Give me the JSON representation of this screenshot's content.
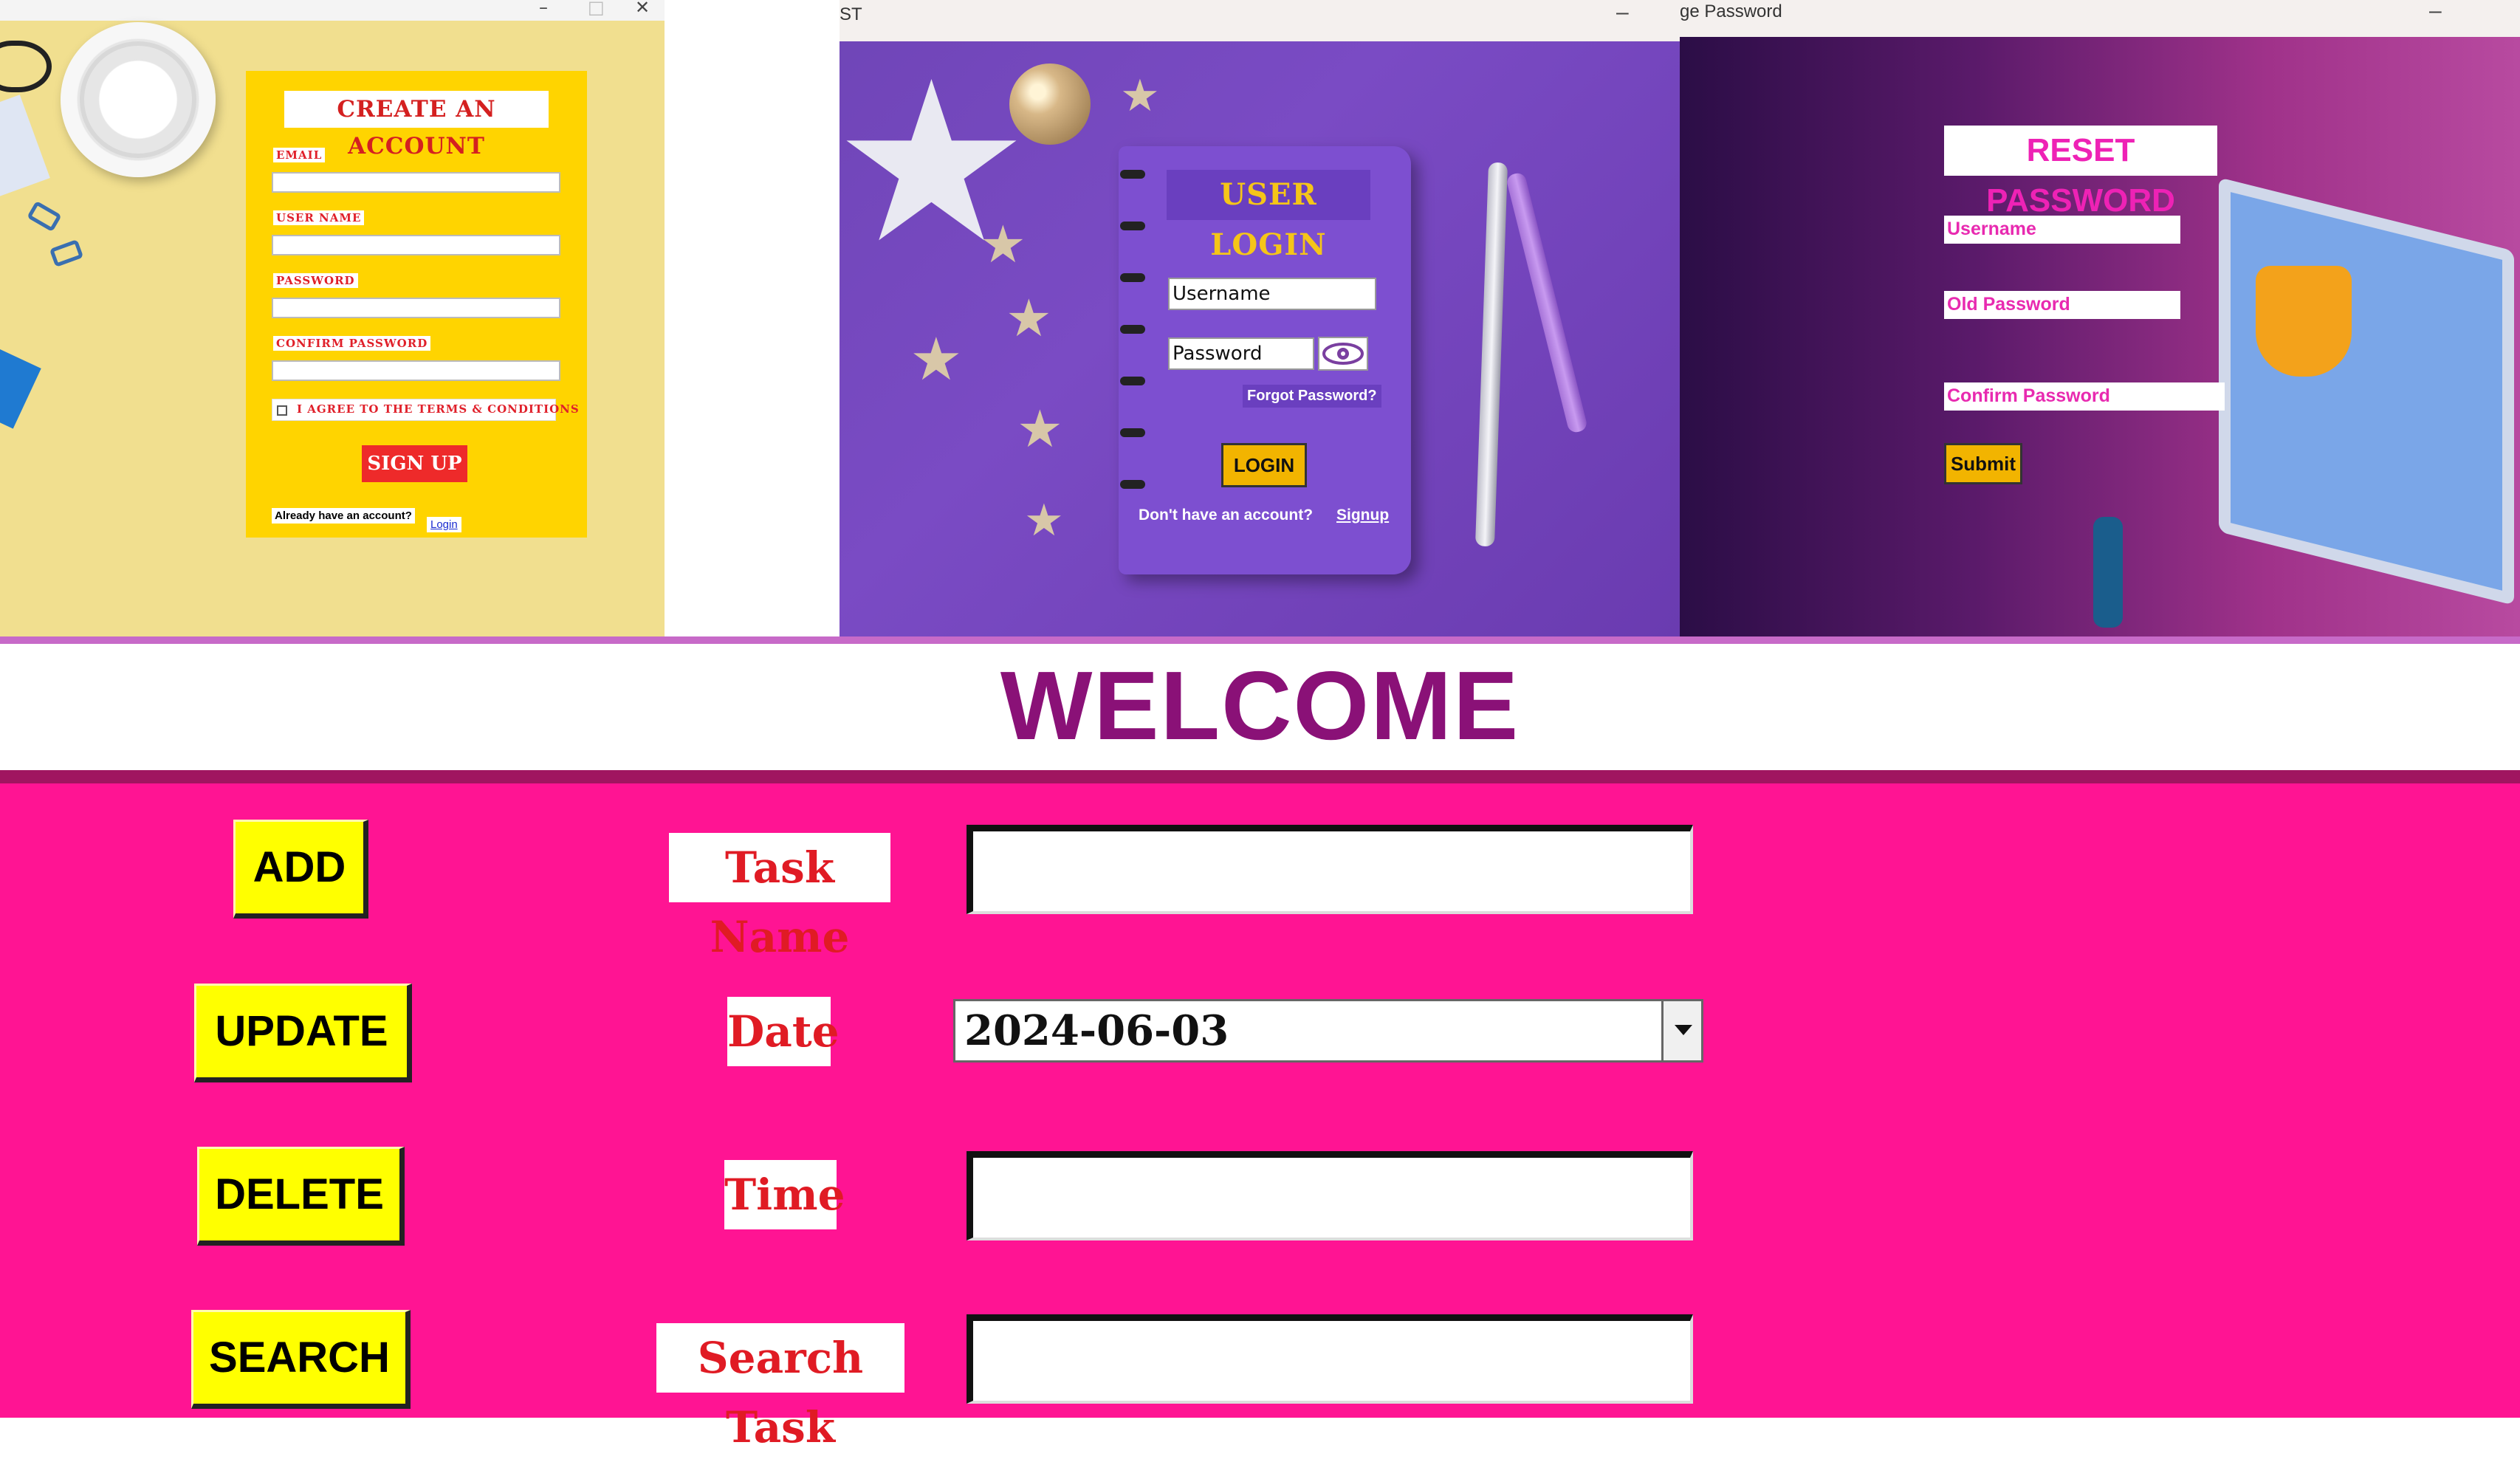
{
  "signup_window": {
    "controls": {
      "minimize": "–",
      "maximize": "□",
      "close": "✕"
    },
    "title": "CREATE AN ACCOUNT",
    "fields": [
      {
        "label": "EMAIL",
        "value": ""
      },
      {
        "label": "USER NAME",
        "value": ""
      },
      {
        "label": "PASSWORD",
        "value": ""
      },
      {
        "label": "CONFIRM PASSWORD",
        "value": ""
      }
    ],
    "terms_label": "I AGREE TO THE TERMS & CONDITIONS",
    "signup_button": "SIGN UP",
    "already_text": "Already have an account?",
    "login_link": "Login"
  },
  "login_window": {
    "title_fragment": "ST",
    "minimize": "–",
    "heading": "USER LOGIN",
    "username_placeholder": "Username",
    "password_placeholder": "Password",
    "forgot": "Forgot Password?",
    "login_button": "LOGIN",
    "no_account": "Don't have an account?",
    "signup_link": "Signup"
  },
  "reset_window": {
    "title_fragment": "ge Password",
    "minimize": "–",
    "heading": "RESET PASSWORD",
    "fields": [
      "Username",
      "Old Password",
      "Confirm Password"
    ],
    "submit_button": "Submit"
  },
  "main": {
    "welcome": "WELCOME",
    "buttons": [
      "ADD",
      "UPDATE",
      "DELETE",
      "SEARCH"
    ],
    "labels": [
      "Task Name",
      "Date",
      "Time",
      "Search Task"
    ],
    "date_value": "2024-06-03",
    "inputs": {
      "task_name": "",
      "time": "",
      "search_task": ""
    }
  },
  "colors": {
    "main_background": "#ff1493",
    "button_yellow": "#ffff00",
    "welcome_text": "#8a1177",
    "label_red": "#e01b24"
  },
  "icons": [
    "eye-icon",
    "dropdown-arrow-icon",
    "checkbox-icon"
  ]
}
